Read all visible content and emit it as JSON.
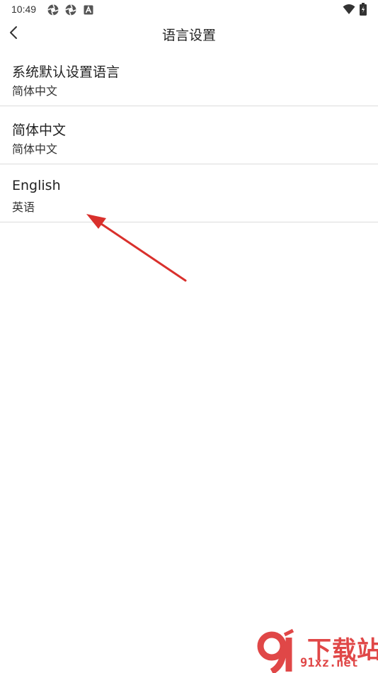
{
  "status_bar": {
    "time": "10:49",
    "left_icons": [
      "aperture-icon",
      "aperture-icon",
      "font-a-icon"
    ],
    "right_icons": [
      "wifi-icon",
      "battery-icon"
    ]
  },
  "app_bar": {
    "back_icon": "chevron-left-icon",
    "title": "语言设置"
  },
  "languages": [
    {
      "name": "系统默认设置语言",
      "subtitle": "简体中文"
    },
    {
      "name": "简体中文",
      "subtitle": "简体中文"
    },
    {
      "name": "English",
      "subtitle": "英语"
    }
  ],
  "annotation": {
    "color": "#d9302c",
    "points_to": "English"
  },
  "watermark": {
    "text": "下载站",
    "domain": "91xz.net",
    "color": "#e04747"
  }
}
